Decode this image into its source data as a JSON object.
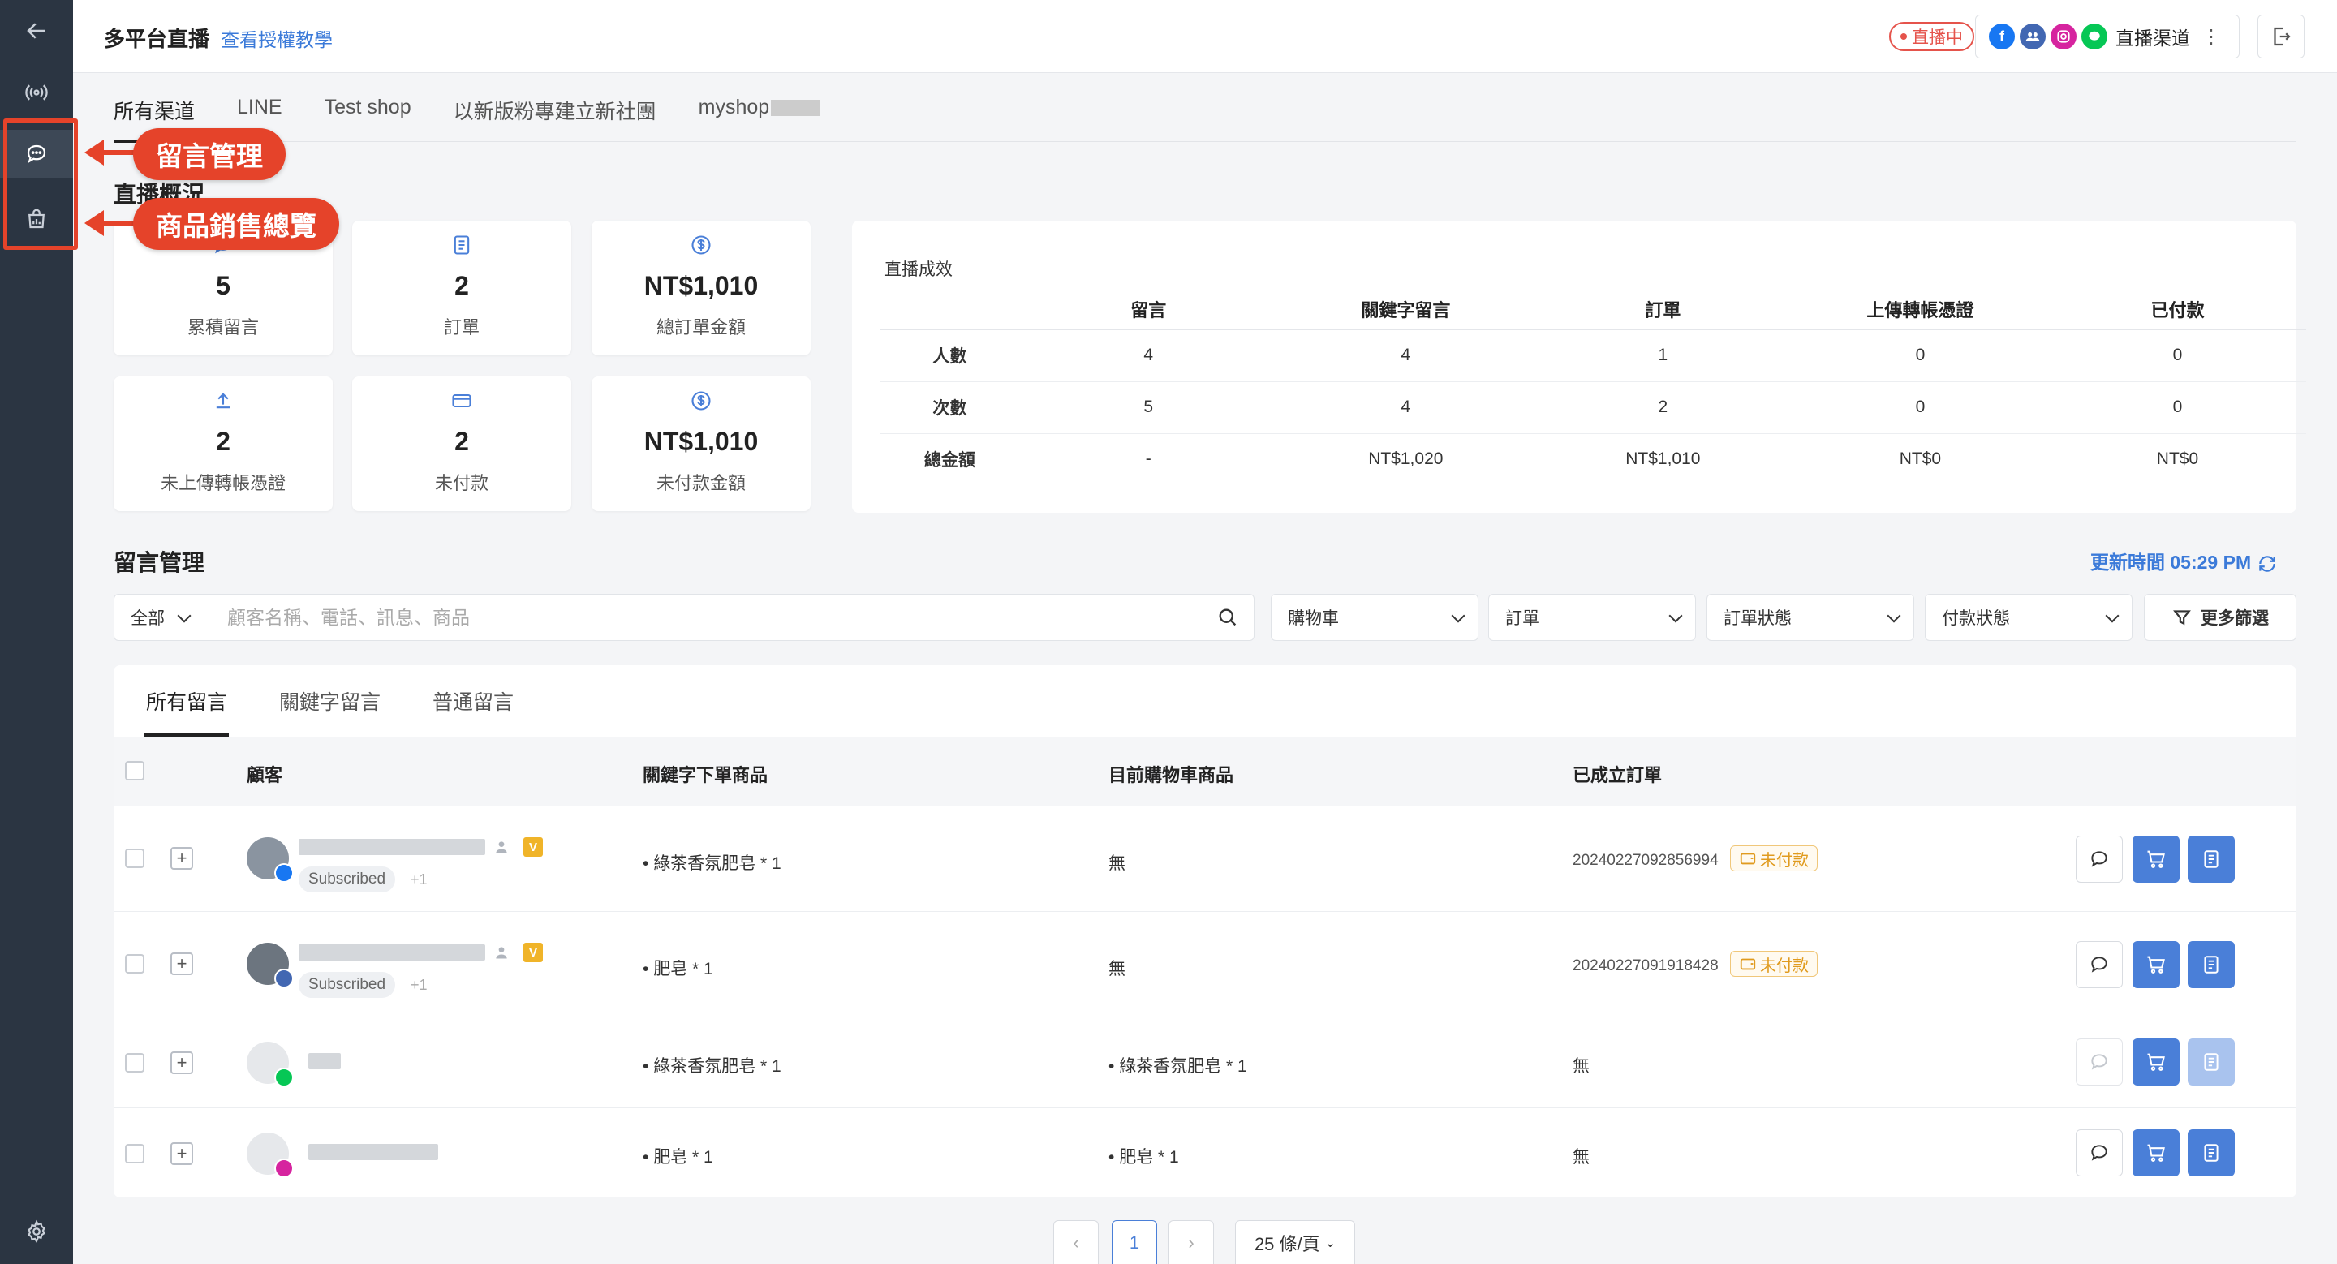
{
  "header": {
    "title": "多平台直播",
    "tutorial_link": "查看授權教學",
    "live_status": "直播中",
    "channel_label": "直播渠道"
  },
  "callouts": {
    "comments": "留言管理",
    "sales": "商品銷售總覽"
  },
  "channel_tabs": [
    "所有渠道",
    "LINE",
    "Test shop",
    "以新版粉專建立新社團",
    "myshop"
  ],
  "overview": {
    "title": "直播概況",
    "cards": [
      {
        "value": "5",
        "label": "累積留言",
        "icon": "comment-icon"
      },
      {
        "value": "2",
        "label": "訂單",
        "icon": "document-icon"
      },
      {
        "value": "NT$1,010",
        "label": "總訂單金額",
        "icon": "dollar-icon"
      },
      {
        "value": "2",
        "label": "未上傳轉帳憑證",
        "icon": "upload-icon"
      },
      {
        "value": "2",
        "label": "未付款",
        "icon": "card-icon"
      },
      {
        "value": "NT$1,010",
        "label": "未付款金額",
        "icon": "dollar-icon"
      }
    ]
  },
  "performance": {
    "title": "直播成效",
    "columns": [
      "留言",
      "關鍵字留言",
      "訂單",
      "上傳轉帳憑證",
      "已付款"
    ],
    "rows": [
      {
        "label": "人數",
        "values": [
          "4",
          "4",
          "1",
          "0",
          "0"
        ]
      },
      {
        "label": "次數",
        "values": [
          "5",
          "4",
          "2",
          "0",
          "0"
        ]
      },
      {
        "label": "總金額",
        "values": [
          "-",
          "NT$1,020",
          "NT$1,010",
          "NT$0",
          "NT$0"
        ]
      }
    ]
  },
  "comments": {
    "title": "留言管理",
    "update_time": "更新時間 05:29 PM",
    "filters": {
      "scope": "全部",
      "search_placeholder": "顧客名稱、電話、訊息、商品",
      "cart": "購物車",
      "order": "訂單",
      "order_status": "訂單狀態",
      "payment_status": "付款狀態",
      "more": "更多篩選"
    },
    "tabs": [
      "所有留言",
      "關鍵字留言",
      "普通留言"
    ],
    "columns": [
      "顧客",
      "關鍵字下單商品",
      "目前購物車商品",
      "已成立訂單"
    ],
    "rows": [
      {
        "subscribed": "Subscribed",
        "extra": "+1",
        "keyword_item": "綠茶香氛肥皂 * 1",
        "cart_item": "無",
        "order_no": "20240227092856994",
        "order_status": "未付款",
        "platform": "facebook"
      },
      {
        "subscribed": "Subscribed",
        "extra": "+1",
        "keyword_item": "肥皂 * 1",
        "cart_item": "無",
        "order_no": "20240227091918428",
        "order_status": "未付款",
        "platform": "group"
      },
      {
        "keyword_item": "綠茶香氛肥皂 * 1",
        "cart_item": "綠茶香氛肥皂 * 1",
        "order_no": "無",
        "platform": "line"
      },
      {
        "keyword_item": "肥皂 * 1",
        "cart_item": "肥皂 * 1",
        "order_no": "無",
        "platform": "instagram"
      }
    ]
  },
  "pagination": {
    "current": "1",
    "page_size": "25 條/頁"
  },
  "colors": {
    "accent": "#4a7fd8",
    "sidebar": "#2b3542",
    "callout": "#e5432a",
    "unpaid": "#e09b1f"
  }
}
